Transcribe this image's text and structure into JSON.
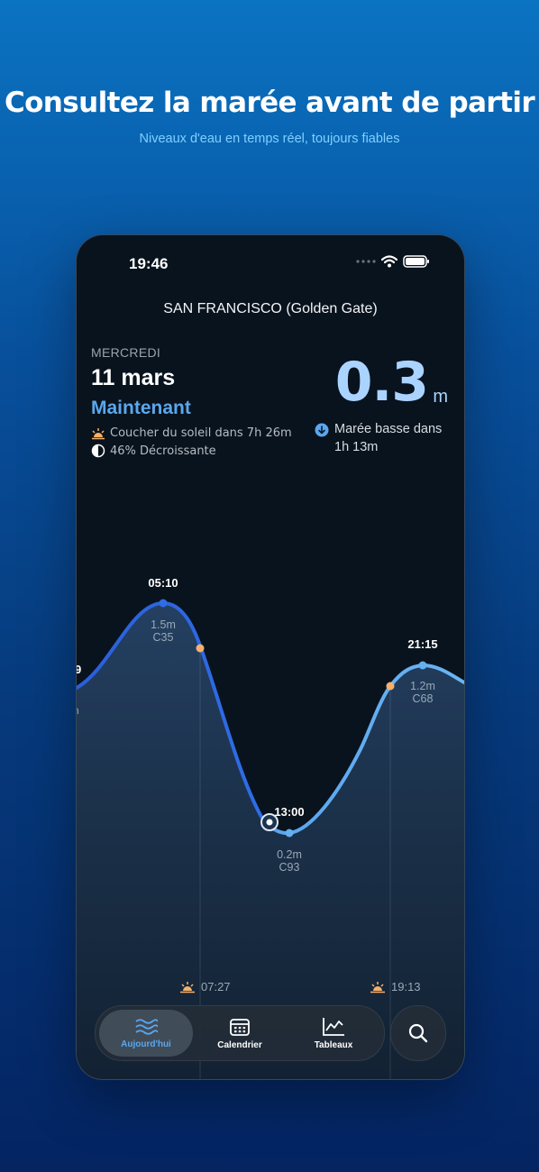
{
  "promo": {
    "headline": "Consultez la marée avant de partir",
    "subline": "Niveaux d'eau en temps réel, toujours fiables"
  },
  "status_bar": {
    "time": "19:46"
  },
  "location": "SAN FRANCISCO (Golden Gate)",
  "today": {
    "day_name": "MERCREDI",
    "date": "11 mars",
    "now_label": "Maintenant",
    "sunset_text": "Coucher du soleil dans 7h 26m",
    "moon_text": "46% Décroissante"
  },
  "current": {
    "height": "0.3",
    "unit": "m",
    "next_tide_label": "Marée basse dans",
    "next_tide_time": "1h 13m"
  },
  "chart_data": {
    "type": "area",
    "points": [
      {
        "time": "05:10",
        "height": "1.5m",
        "coef": "C35",
        "kind": "high"
      },
      {
        "time": "13:00",
        "height": "0.2m",
        "coef": "C93",
        "kind": "low"
      },
      {
        "time": "21:15",
        "height": "1.2m",
        "coef": "C68",
        "kind": "high"
      }
    ],
    "left_edge_label": "9",
    "left_edge_sub": "n",
    "sunrise": "07:27",
    "sunset": "19:13"
  },
  "tabs": [
    {
      "label": "Aujourd'hui",
      "icon": "waves-icon",
      "active": true
    },
    {
      "label": "Calendrier",
      "icon": "calendar-icon",
      "active": false
    },
    {
      "label": "Tableaux",
      "icon": "chart-icon",
      "active": false
    }
  ],
  "colors": {
    "accent": "#5aa8ee",
    "curve_past": "#2f6de6",
    "curve_future": "#64b0f0",
    "sun_marker": "#f6b06b"
  }
}
